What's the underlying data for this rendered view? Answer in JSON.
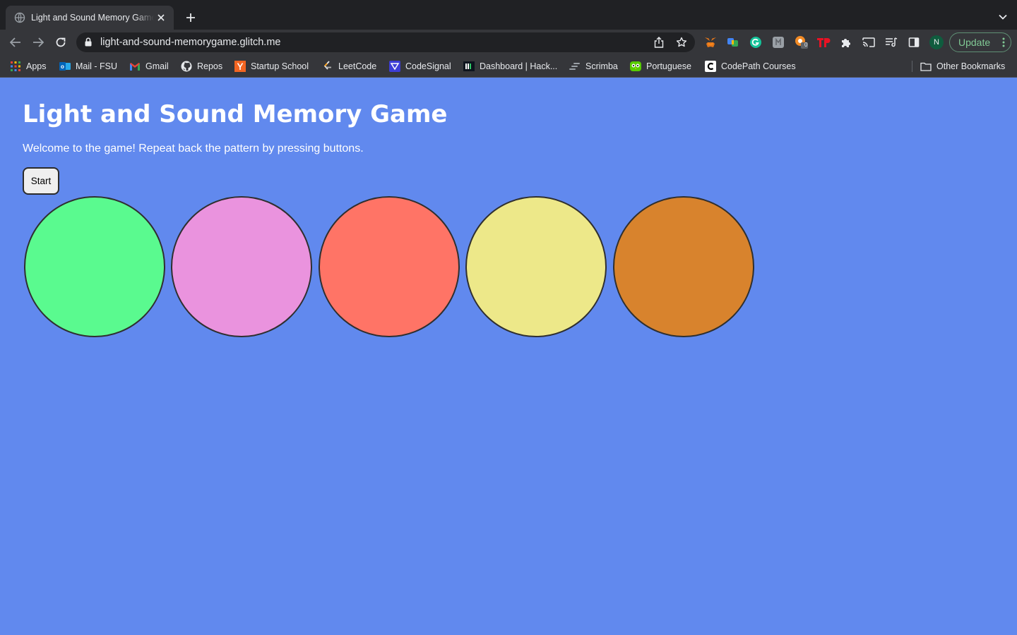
{
  "browser": {
    "tab_title": "Light and Sound Memory Game",
    "url": "light-and-sound-memorygame.glitch.me",
    "update_label": "Update",
    "profile_initial": "N",
    "extension_badge": "0"
  },
  "bookmarks": {
    "items": [
      {
        "label": "Apps",
        "icon": "apps-grid-icon"
      },
      {
        "label": "Mail - FSU",
        "icon": "outlook-icon"
      },
      {
        "label": "Gmail",
        "icon": "gmail-icon"
      },
      {
        "label": "Repos",
        "icon": "github-icon"
      },
      {
        "label": "Startup School",
        "icon": "ycombinator-icon"
      },
      {
        "label": "LeetCode",
        "icon": "leetcode-icon"
      },
      {
        "label": "CodeSignal",
        "icon": "codesignal-icon"
      },
      {
        "label": "Dashboard | Hack...",
        "icon": "hackerrank-icon"
      },
      {
        "label": "Scrimba",
        "icon": "scrimba-icon"
      },
      {
        "label": "Portuguese",
        "icon": "duolingo-icon"
      },
      {
        "label": "CodePath Courses",
        "icon": "codepath-icon"
      }
    ],
    "other_label": "Other Bookmarks"
  },
  "game": {
    "title": "Light and Sound Memory Game",
    "intro": "Welcome to the game! Repeat back the pattern by pressing buttons.",
    "start_label": "Start",
    "buttons": [
      {
        "color": "#5afa8f"
      },
      {
        "color": "#ea93de"
      },
      {
        "color": "#ff7466"
      },
      {
        "color": "#ede889"
      },
      {
        "color": "#d8832d"
      }
    ]
  },
  "colors": {
    "page_background": "#6189ee",
    "chrome_dark": "#202124",
    "chrome_toolbar": "#35363a"
  }
}
